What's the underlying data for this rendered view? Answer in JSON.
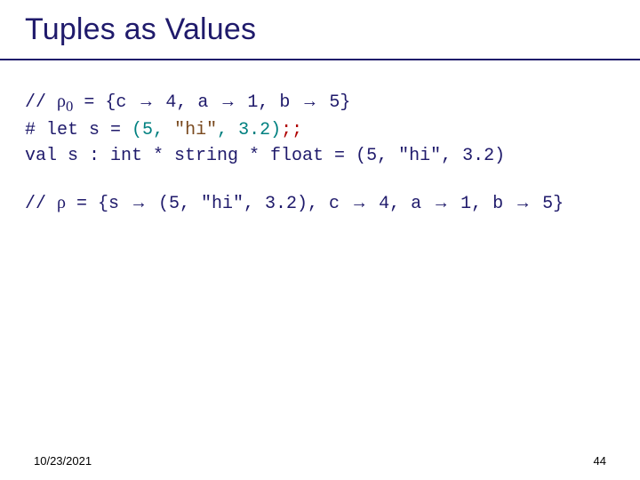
{
  "title": "Tuples as Values",
  "code": {
    "l1": {
      "pre": "//  ",
      "rho": "ρ",
      "sub": "0",
      "eq": " = {c ",
      "arr1": "→",
      "v1": " 4, a ",
      "arr2": "→",
      "v2": " 1, b ",
      "arr3": "→",
      "v3": " 5}"
    },
    "l2": {
      "a": "# let s = ",
      "tuple_open": "(",
      "n1": "5",
      "c1": ", ",
      "str": "\"hi\"",
      "c2": ", ",
      "n2": "3.2",
      "tuple_close": ")",
      "tail": ";;"
    },
    "l3": "val s : int * string * float = (5, \"hi\", 3.2)",
    "l4": {
      "pre": "//  ",
      "rho": "ρ",
      "eq": " = {s ",
      "arr1": "→",
      "tuple": " (5, \"hi\", 3.2), c ",
      "arr2": "→",
      "v2": " 4, a ",
      "arr3": "→",
      "v3": " 1, b ",
      "arr4": "→",
      "v4": " 5}"
    }
  },
  "footer": {
    "date": "10/23/2021",
    "page": "44"
  }
}
